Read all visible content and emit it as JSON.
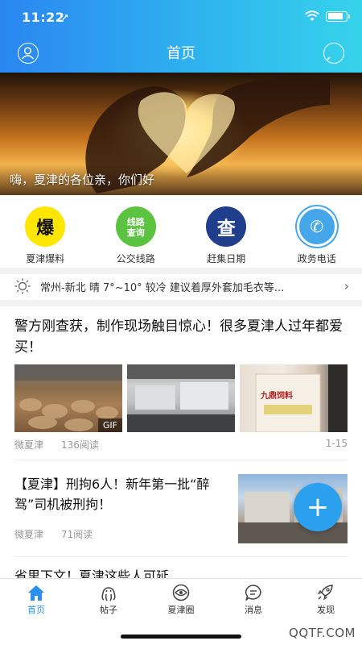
{
  "status_bar": {
    "time": "11:22",
    "location_arrow": "➚"
  },
  "header": {
    "title": "首页",
    "left_icon": "user-icon",
    "right_icon": "chat-icon",
    "gradient": [
      "#2a86f1",
      "#36d3ec"
    ]
  },
  "banner": {
    "caption": "嗨，夏津的各位亲，你们好"
  },
  "quick_links": [
    {
      "icon_text": "爆",
      "label": "夏津爆料"
    },
    {
      "icon_text": "线路\n查询",
      "label": "公交线路"
    },
    {
      "icon_text": "查",
      "label": "赶集日期"
    },
    {
      "icon_text": "✆",
      "label": "政务电话"
    }
  ],
  "weather": {
    "text": "常州-新北 晴 7°~10° 较冷 建议着厚外套加毛衣等...",
    "arrow": "›"
  },
  "articles": [
    {
      "title": "警方刚查获，制作现场触目惊心！很多夏津人过年都爱买！",
      "source": "微夏津",
      "reads": "136阅读",
      "gif_badge": "GIF",
      "image_counter": "1-15",
      "product_label": "九鼎饲料"
    },
    {
      "title": "【夏津】刑拘6人！新年第一批“醉驾”司机被刑拘！",
      "source": "微夏津",
      "reads": "71阅读"
    },
    {
      "title": "省里下文！夏津这些人可延"
    }
  ],
  "fab": {
    "label": "+"
  },
  "tabs": [
    {
      "label": "首页",
      "icon": "home-icon",
      "active": true
    },
    {
      "label": "帖子",
      "icon": "octopus-icon",
      "active": false
    },
    {
      "label": "夏津圈",
      "icon": "eye-icon",
      "active": false
    },
    {
      "label": "消息",
      "icon": "message-icon",
      "active": false
    },
    {
      "label": "发现",
      "icon": "rocket-icon",
      "active": false
    }
  ],
  "watermark": "QQTF.COM",
  "colors": {
    "accent": "#2a90ee",
    "fab": "#2aa0ee"
  }
}
